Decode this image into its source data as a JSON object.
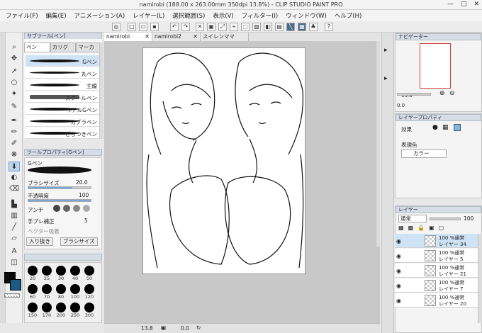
{
  "window": {
    "title": "namirobi (188.00 x 263.00mm 350dpi 13.8%) - CLIP STUDIO PAINT PRO",
    "min": "—",
    "max": "□",
    "close": "✕"
  },
  "menu": [
    "ファイル(F)",
    "編集(E)",
    "アニメーション(A)",
    "レイヤー(L)",
    "選択範囲(S)",
    "表示(V)",
    "フィルター(I)",
    "ウィンドウ(W)",
    "ヘルプ(H)"
  ],
  "doc_tabs": [
    {
      "label": "namirobi",
      "close": "✕"
    },
    {
      "label": "namirobi2",
      "close": "✕"
    },
    {
      "label": "スイレンママ",
      "close": ""
    }
  ],
  "subtool": {
    "header": "サブツール[ペン]",
    "tabs": [
      "ペン",
      "カリグ",
      "マーカ"
    ],
    "brushes": [
      "Gペン",
      "丸ペン",
      "主線",
      "スクールペン",
      "リアルGペン",
      "カブラペン",
      "ざらつきペン"
    ]
  },
  "tool_property": {
    "header": "ツールプロパティ[Gペン]",
    "name": "Gペン",
    "brush_size_label": "ブラシサイズ",
    "brush_size_value": "20.0",
    "brush_size_fraction": 0.7,
    "opacity_label": "不透明度",
    "opacity_value": "100",
    "opacity_fraction": 1.0,
    "antialias_label": "アンチ",
    "stabilization_label": "手ブレ補正",
    "stabilization_value": "5",
    "vector_label": "ベクター吸着",
    "inout_label": "入り抜き",
    "brushsize_btn": "ブラシサイズ"
  },
  "brush_sizes": [
    "20",
    "25",
    "30",
    "40",
    "50",
    "60",
    "70",
    "80",
    "100",
    "120",
    "150",
    "170",
    "200",
    "250",
    "300"
  ],
  "navigator": {
    "header": "ナビゲーター",
    "zoom": "13.8",
    "angle": "0.0"
  },
  "layer_property": {
    "header": "レイヤープロパティ",
    "effect_label": "効果",
    "color_label": "表現色",
    "color_value": "カラー"
  },
  "layers": {
    "header": "レイヤー",
    "blend": "通常",
    "opacity": "100",
    "items": [
      {
        "pct": "100 %通常",
        "name": "レイヤー 34"
      },
      {
        "pct": "100 %通常",
        "name": "レイヤー 5"
      },
      {
        "pct": "100 %通常",
        "name": "レイヤー 21"
      },
      {
        "pct": "100 %通常",
        "name": "レイヤー 7"
      },
      {
        "pct": "100 %通常",
        "name": "レイヤー 20"
      }
    ]
  },
  "status": {
    "zoom": "13.8",
    "angle": "0.0"
  },
  "colors": {
    "main": "#0b0b0b",
    "sub": "#1a5a85",
    "accent": "#7aa8d8",
    "selected_row": "#cfe3f6"
  }
}
